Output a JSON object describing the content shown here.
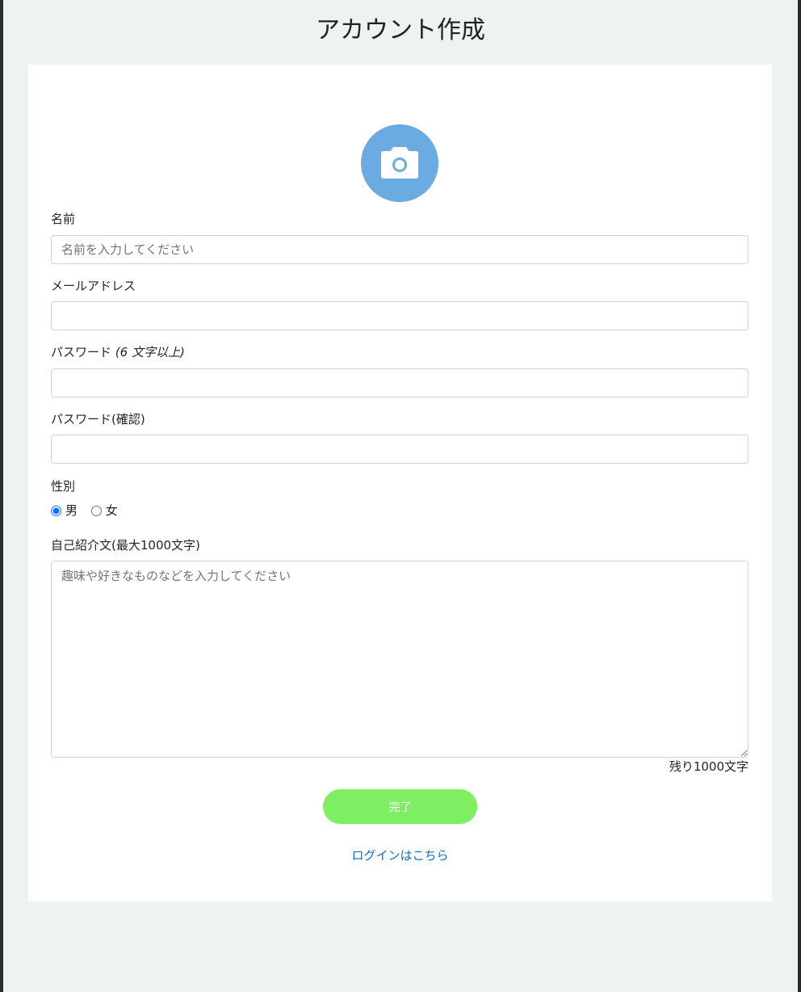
{
  "page": {
    "title": "アカウント作成"
  },
  "avatar": {
    "icon": "camera-icon",
    "color": "#6aabe1"
  },
  "form": {
    "name": {
      "label": "名前",
      "placeholder": "名前を入力してください",
      "value": ""
    },
    "email": {
      "label": "メールアドレス",
      "value": ""
    },
    "password": {
      "label": "パスワード",
      "hint": "(6 文字以上)",
      "value": ""
    },
    "password_confirm": {
      "label": "パスワード(確認)",
      "value": ""
    },
    "gender": {
      "label": "性別",
      "options": [
        {
          "label": "男",
          "selected": true
        },
        {
          "label": "女",
          "selected": false
        }
      ]
    },
    "bio": {
      "label": "自己紹介文(最大1000文字)",
      "placeholder": "趣味や好きなものなどを入力してください",
      "value": "",
      "remaining_text": "残り1000文字"
    },
    "submit_label": "完了",
    "submit_color": "#80ee62",
    "login_link_label": "ログインはこちら",
    "link_color": "#0d6fcf"
  }
}
